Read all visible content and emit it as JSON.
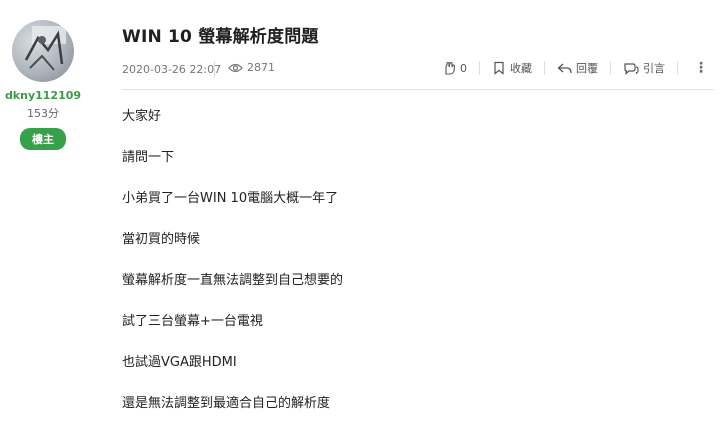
{
  "author": {
    "username": "dkny112109",
    "score": "153分",
    "badge": "樓主"
  },
  "post": {
    "title": "WIN 10 螢幕解析度問題",
    "date": "2020-03-26 22:07",
    "views": "2871",
    "actions": {
      "like_count": "0",
      "favorite_label": "收藏",
      "reply_label": "回覆",
      "quote_label": "引言"
    },
    "paragraphs": [
      "大家好",
      "請問一下",
      "小弟買了一台WIN 10電腦大概一年了",
      "當初買的時候",
      "螢幕解析度一直無法調整到自己想要的",
      "試了三台螢幕+一台電視",
      "也試過VGA跟HDMI",
      "還是無法調整到最適合自己的解析度"
    ]
  }
}
